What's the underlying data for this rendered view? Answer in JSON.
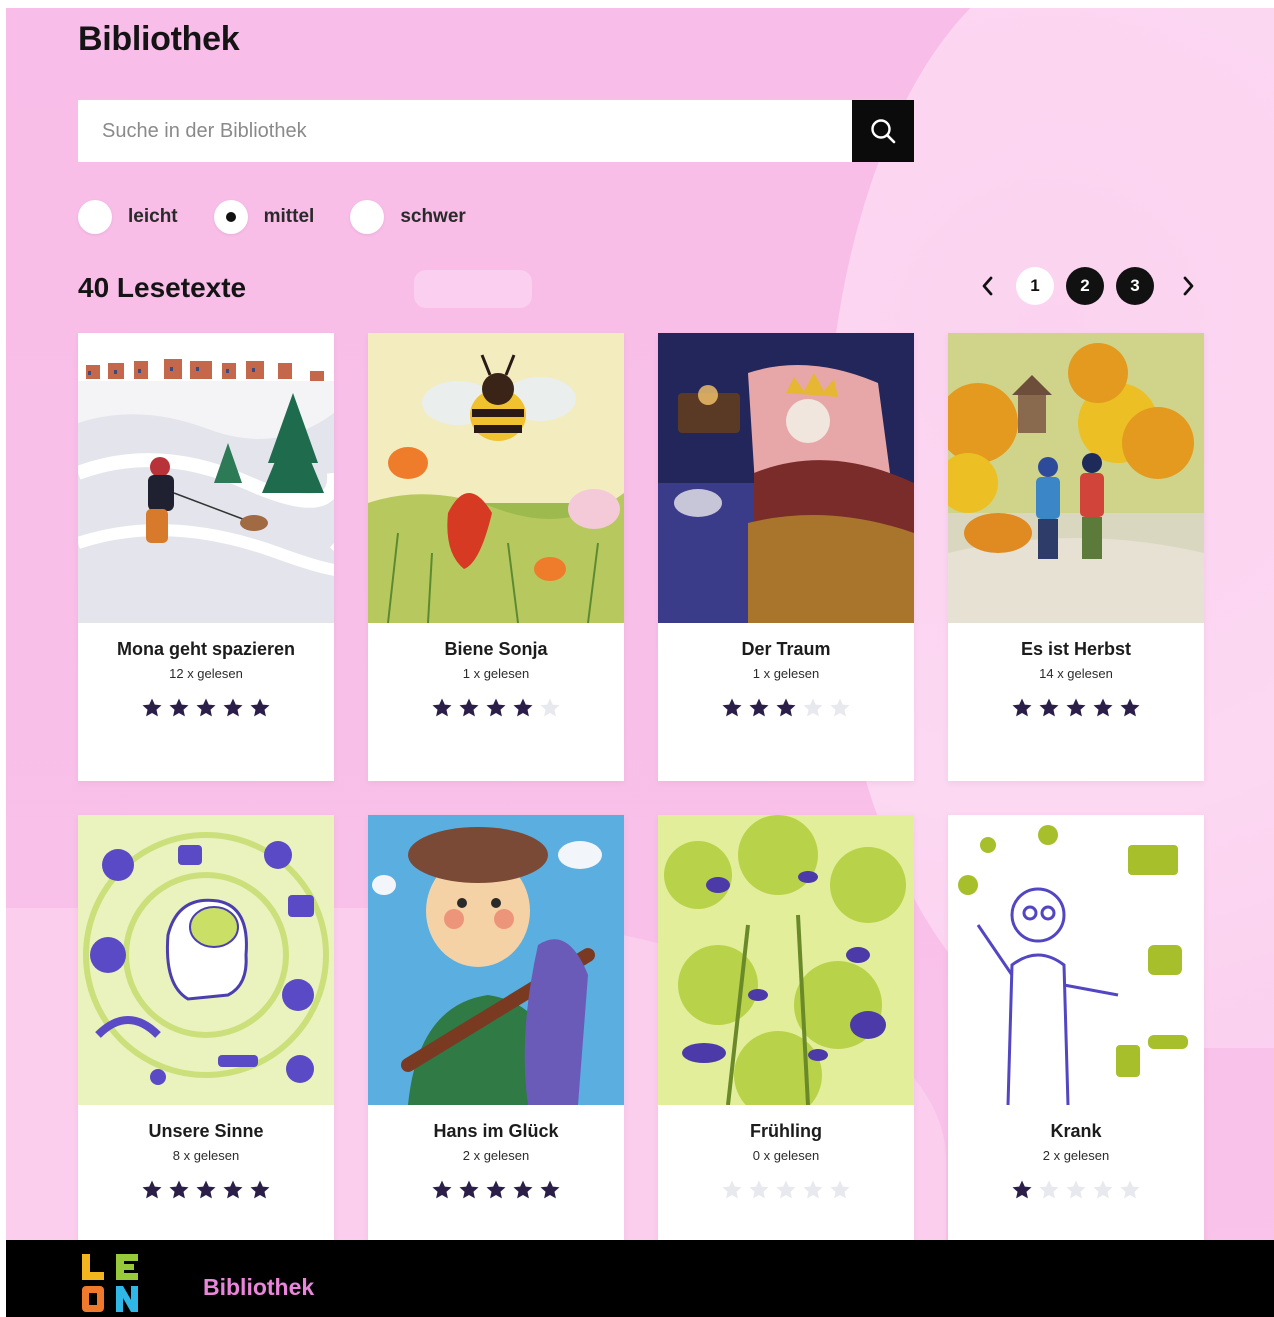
{
  "page": {
    "title": "Bibliothek"
  },
  "search": {
    "placeholder": "Suche in der Bibliothek",
    "icon": "search-icon"
  },
  "levels": [
    {
      "label": "leicht",
      "selected": false
    },
    {
      "label": "mittel",
      "selected": true
    },
    {
      "label": "schwer",
      "selected": false
    }
  ],
  "results": {
    "count_label": "40 Lesetexte"
  },
  "pagination": {
    "pages": [
      "1",
      "2",
      "3"
    ],
    "current": "1"
  },
  "books": [
    {
      "title": "Mona geht spazieren",
      "reads": "12 x gelesen",
      "stars": 5
    },
    {
      "title": "Biene Sonja",
      "reads": "1 x gelesen",
      "stars": 4
    },
    {
      "title": "Der Traum",
      "reads": "1 x gelesen",
      "stars": 3
    },
    {
      "title": "Es ist Herbst",
      "reads": "14 x gelesen",
      "stars": 5
    },
    {
      "title": "Unsere Sinne",
      "reads": "8 x gelesen",
      "stars": 5
    },
    {
      "title": "Hans im Glück",
      "reads": "2 x gelesen",
      "stars": 5
    },
    {
      "title": "Frühling",
      "reads": "0 x gelesen",
      "stars": 0
    },
    {
      "title": "Krank",
      "reads": "2 x gelesen",
      "stars": 1
    }
  ],
  "rating_max": 5,
  "colors": {
    "background_pink": "#f8bde8",
    "star_filled": "#2b1f4a",
    "star_empty": "#e8e8ef",
    "footer_bg": "#000000",
    "footer_link": "#e985da"
  },
  "footer": {
    "logo_icon": "leon-logo-icon",
    "nav_label": "Bibliothek"
  }
}
